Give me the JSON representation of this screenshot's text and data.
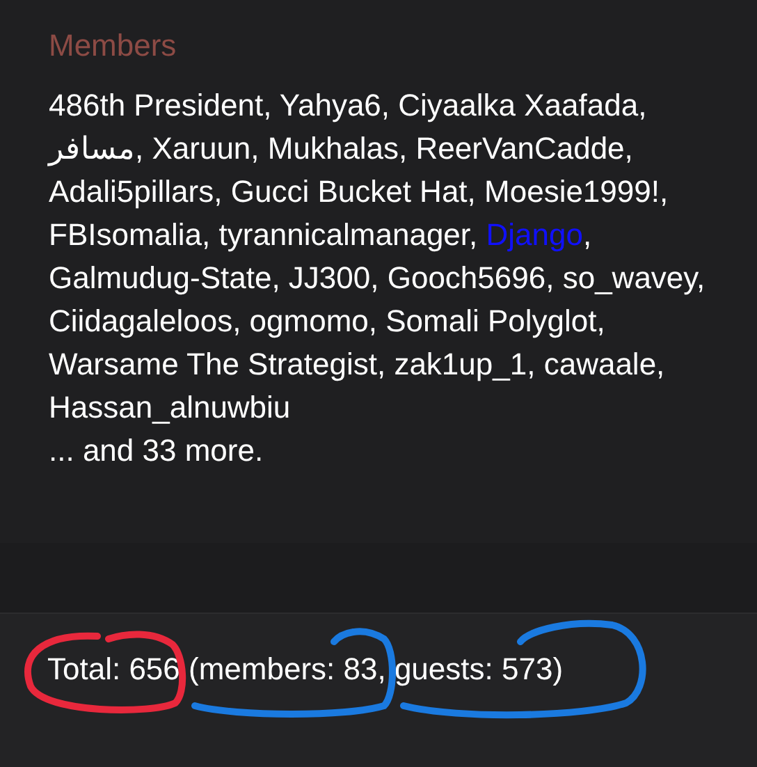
{
  "members_panel": {
    "title": "Members",
    "list": [
      {
        "kind": "text",
        "text": "486th President, Yahya6, Ciyaalka Xaafada, مسافر, Xaruun, Mukhalas, ReerVanCadde, Adali5pillars, Gucci Bucket Hat, Moesie1999!, FBIsomalia, tyrannicalmanager, "
      },
      {
        "kind": "link",
        "text": "Django"
      },
      {
        "kind": "text",
        "text": ", Galmudug-State, JJ300, Gooch5696, so_wavey, Ciidagaleloos, ogmomo, Somali Polyglot, Warsame The Strategist, zak1up_1, cawaale, Hassan_alnuwbiu"
      }
    ],
    "more": "... and 33 more."
  },
  "footer": {
    "total": "Total: 656 (members: 83, guests: 573)"
  },
  "annotations": [
    {
      "color": "#e8283c"
    },
    {
      "color": "#1a7ae0"
    },
    {
      "color": "#1a7ae0"
    }
  ]
}
